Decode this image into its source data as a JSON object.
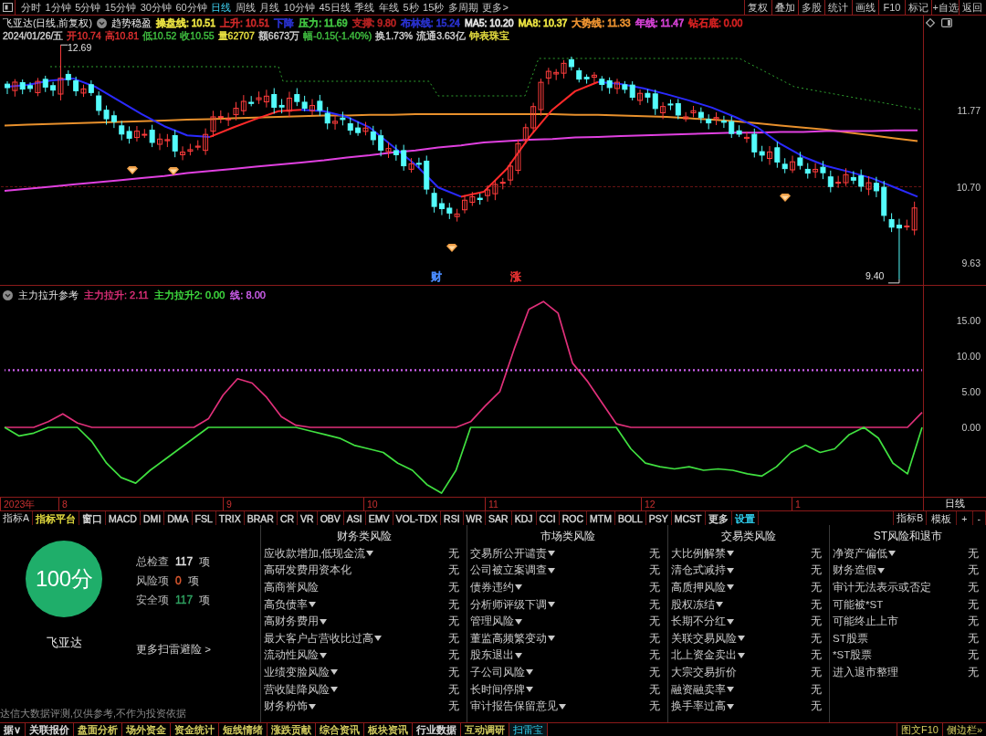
{
  "toolbar": {
    "periods": [
      {
        "label": "分时",
        "selected": false
      },
      {
        "label": "1分钟",
        "selected": false
      },
      {
        "label": "5分钟",
        "selected": false
      },
      {
        "label": "15分钟",
        "selected": false
      },
      {
        "label": "30分钟",
        "selected": false
      },
      {
        "label": "60分钟",
        "selected": false
      },
      {
        "label": "日线",
        "selected": true
      },
      {
        "label": "周线",
        "selected": false
      },
      {
        "label": "月线",
        "selected": false
      },
      {
        "label": "10分钟",
        "selected": false
      },
      {
        "label": "45日线",
        "selected": false
      },
      {
        "label": "季线",
        "selected": false
      },
      {
        "label": "年线",
        "selected": false
      },
      {
        "label": "5秒",
        "selected": false
      },
      {
        "label": "15秒",
        "selected": false
      },
      {
        "label": "多周期",
        "selected": false
      }
    ],
    "more": "更多>",
    "buttons": [
      "复权",
      "叠加",
      "多股",
      "统计",
      "画线",
      "F10",
      "标记",
      "+自选",
      "返回"
    ]
  },
  "price_chart": {
    "title": "飞亚达(日线,前复权)",
    "indicator_name": "趋势稳盈",
    "indicator_values": [
      {
        "text": "操盘线: 10.51",
        "color": "#e8e040"
      },
      {
        "text": "上升: 10.51",
        "color": "#c82828"
      },
      {
        "text": "下降",
        "color": "#2830c8"
      },
      {
        "text": "压力: 11.69",
        "color": "#40c040"
      },
      {
        "text": "支撑: 9.80",
        "color": "#b02020"
      },
      {
        "text": "布林线: 15.24",
        "color": "#2830c8"
      },
      {
        "text": "MA5: 10.20",
        "color": "#e0e0e0"
      },
      {
        "text": "MA8: 10.37",
        "color": "#e8e040"
      },
      {
        "text": "大势线: 11.33",
        "color": "#e89030"
      },
      {
        "text": "年线: 11.47",
        "color": "#d040d0"
      },
      {
        "text": "钻石底: 0.00",
        "color": "#d02020"
      }
    ],
    "bar_info": [
      {
        "text": "2024/01/26/五",
        "color": "#d0d0d0"
      },
      {
        "text": "开10.74",
        "color": "#e03030"
      },
      {
        "text": "高10.81",
        "color": "#e03030"
      },
      {
        "text": "低10.52",
        "color": "#40c040"
      },
      {
        "text": "收10.55",
        "color": "#40c040"
      },
      {
        "text": "量62707",
        "color": "#e8e040"
      },
      {
        "text": "额6673万",
        "color": "#d0d0d0"
      },
      {
        "text": "幅-0.15(-1.40%)",
        "color": "#40c040"
      },
      {
        "text": "换1.73%",
        "color": "#d0d0d0"
      },
      {
        "text": "流通3.63亿",
        "color": "#d0d0d0"
      },
      {
        "text": "钟表珠宝",
        "color": "#e8e040"
      }
    ],
    "price_axis": [
      "11.77",
      "10.70",
      "9.63"
    ],
    "high_label": "12.69",
    "low_label": "9.40",
    "markers": [
      {
        "text": "财",
        "color": "#4a8cff"
      },
      {
        "text": "涨",
        "color": "#e03030"
      }
    ]
  },
  "indicator": {
    "name": "主力拉升参考",
    "chart_data": {
      "type": "line",
      "ylim": [
        -9.7,
        19.8
      ],
      "yticks": [
        {
          "value": 0,
          "label": "0.00"
        },
        {
          "value": 5,
          "label": "5.00"
        },
        {
          "value": 10,
          "label": "10.00"
        },
        {
          "value": 15,
          "label": "15.00"
        }
      ],
      "series": [
        {
          "name": "主力拉升: 2.11",
          "color": "#e0307a",
          "values": [
            0,
            0,
            0,
            0.8,
            1.9,
            0.6,
            0,
            0,
            0,
            0,
            0,
            0,
            0,
            0,
            1.2,
            4.5,
            6.8,
            6.2,
            4.2,
            1.5,
            0.3,
            0,
            0,
            0,
            0,
            0,
            0,
            0,
            0,
            0,
            0,
            0,
            0.8,
            3,
            5,
            11,
            16.5,
            17.6,
            16,
            9,
            6.5,
            3.5,
            0.5,
            0,
            0,
            0,
            0,
            0,
            0,
            0,
            0,
            0,
            0,
            0,
            0,
            0,
            0,
            0,
            0,
            0,
            0,
            0,
            0,
            2.1
          ]
        },
        {
          "name": "主力拉升2: 0.00",
          "color": "#40e040",
          "values": [
            0,
            -1.2,
            -0.8,
            0,
            0,
            0,
            -2,
            -5,
            -7,
            -7.8,
            -6,
            -4.5,
            -3,
            -1.5,
            0,
            0,
            0,
            0,
            0,
            0,
            0,
            -0.5,
            -1,
            -1.5,
            -2.5,
            -3,
            -3.5,
            -5,
            -6,
            -8,
            -9.2,
            -6,
            0,
            0,
            0,
            0,
            0,
            0,
            0,
            0,
            0,
            0,
            0,
            -3,
            -5,
            -5.5,
            -5.8,
            -5.5,
            -6,
            -5.8,
            -6,
            -6.5,
            -6.8,
            -5.5,
            -3.5,
            -2.5,
            -3.5,
            -3,
            -1,
            0,
            -1.5,
            -5,
            -6.5,
            0
          ]
        },
        {
          "name": "线: 8.00",
          "color": "#d060f0",
          "line_style": "dashed",
          "values": [
            8,
            8,
            8,
            8,
            8,
            8,
            8,
            8,
            8,
            8,
            8,
            8,
            8,
            8,
            8,
            8,
            8,
            8,
            8,
            8,
            8,
            8,
            8,
            8,
            8,
            8,
            8,
            8,
            8,
            8,
            8,
            8,
            8,
            8,
            8,
            8,
            8,
            8,
            8,
            8,
            8,
            8,
            8,
            8,
            8,
            8,
            8,
            8,
            8,
            8,
            8,
            8,
            8,
            8,
            8,
            8,
            8,
            8,
            8,
            8,
            8,
            8,
            8,
            8
          ]
        }
      ]
    }
  },
  "date_axis": {
    "labels": [
      "2023年",
      "8",
      "9",
      "10",
      "11",
      "12",
      "1"
    ],
    "period": "日线"
  },
  "indicator_tabs": {
    "left_label": "指标A",
    "tabs": [
      {
        "label": "指标平台",
        "color": "#e8e040"
      },
      {
        "label": "窗口",
        "color": "#d8d8d8"
      },
      {
        "label": "MACD",
        "color": "#d8d8d8"
      },
      {
        "label": "DMI",
        "color": "#d8d8d8"
      },
      {
        "label": "DMA",
        "color": "#d8d8d8"
      },
      {
        "label": "FSL",
        "color": "#d8d8d8"
      },
      {
        "label": "TRIX",
        "color": "#d8d8d8"
      },
      {
        "label": "BRAR",
        "color": "#d8d8d8"
      },
      {
        "label": "CR",
        "color": "#d8d8d8"
      },
      {
        "label": "VR",
        "color": "#d8d8d8"
      },
      {
        "label": "OBV",
        "color": "#d8d8d8"
      },
      {
        "label": "ASI",
        "color": "#d8d8d8"
      },
      {
        "label": "EMV",
        "color": "#d8d8d8"
      },
      {
        "label": "VOL-TDX",
        "color": "#d8d8d8"
      },
      {
        "label": "RSI",
        "color": "#d8d8d8"
      },
      {
        "label": "WR",
        "color": "#d8d8d8"
      },
      {
        "label": "SAR",
        "color": "#d8d8d8"
      },
      {
        "label": "KDJ",
        "color": "#d8d8d8"
      },
      {
        "label": "CCI",
        "color": "#d8d8d8"
      },
      {
        "label": "ROC",
        "color": "#d8d8d8"
      },
      {
        "label": "MTM",
        "color": "#d8d8d8"
      },
      {
        "label": "BOLL",
        "color": "#d8d8d8"
      },
      {
        "label": "PSY",
        "color": "#d8d8d8"
      },
      {
        "label": "MCST",
        "color": "#d8d8d8"
      },
      {
        "label": "更多",
        "color": "#d8d8d8"
      },
      {
        "label": "设置",
        "color": "#30d0f0"
      }
    ],
    "right_label": "指标B",
    "right_buttons": [
      "模板",
      "+",
      "-"
    ]
  },
  "risk_scan": {
    "score": "100分",
    "stock_name": "飞亚达",
    "stats": [
      {
        "label": "总检查",
        "value": "117",
        "unit": "项",
        "color": "#e0e0e0"
      },
      {
        "label": "风险项",
        "value": "0",
        "unit": "项",
        "color": "#e05a30"
      },
      {
        "label": "安全项",
        "value": "117",
        "unit": "项",
        "color": "#2fa060"
      }
    ],
    "more_link": "更多扫雷避险 >",
    "disclaimer": "达信大数据评测,仅供参考,不作为投资依据",
    "columns": [
      {
        "title": "财务类风险",
        "rows": [
          {
            "label": "应收款增加,低现金流",
            "expandable": true,
            "result": "无"
          },
          {
            "label": "高研发费用资本化",
            "expandable": false,
            "result": "无"
          },
          {
            "label": "高商誉风险",
            "expandable": false,
            "result": "无"
          },
          {
            "label": "高负债率",
            "expandable": true,
            "result": "无"
          },
          {
            "label": "高财务费用",
            "expandable": true,
            "result": "无"
          },
          {
            "label": "最大客户占营收比过高",
            "expandable": true,
            "result": "无"
          },
          {
            "label": "流动性风险",
            "expandable": true,
            "result": "无"
          },
          {
            "label": "业绩变脸风险",
            "expandable": true,
            "result": "无"
          },
          {
            "label": "营收陡降风险",
            "expandable": true,
            "result": "无"
          },
          {
            "label": "财务粉饰",
            "expandable": true,
            "result": "无"
          }
        ]
      },
      {
        "title": "市场类风险",
        "rows": [
          {
            "label": "交易所公开谴责",
            "expandable": true,
            "result": "无"
          },
          {
            "label": "公司被立案调查",
            "expandable": true,
            "result": "无"
          },
          {
            "label": "债券违约",
            "expandable": true,
            "result": "无"
          },
          {
            "label": "分析师评级下调",
            "expandable": true,
            "result": "无"
          },
          {
            "label": "管理风险",
            "expandable": true,
            "result": "无"
          },
          {
            "label": "董监高频繁变动",
            "expandable": true,
            "result": "无"
          },
          {
            "label": "股东退出",
            "expandable": true,
            "result": "无"
          },
          {
            "label": "子公司风险",
            "expandable": true,
            "result": "无"
          },
          {
            "label": "长时间停牌",
            "expandable": true,
            "result": "无"
          },
          {
            "label": "审计报告保留意见",
            "expandable": true,
            "result": "无"
          }
        ]
      },
      {
        "title": "交易类风险",
        "rows": [
          {
            "label": "大比例解禁",
            "expandable": true,
            "result": "无"
          },
          {
            "label": "清仓式减持",
            "expandable": true,
            "result": "无"
          },
          {
            "label": "高质押风险",
            "expandable": true,
            "result": "无"
          },
          {
            "label": "股权冻结",
            "expandable": true,
            "result": "无"
          },
          {
            "label": "长期不分红",
            "expandable": true,
            "result": "无"
          },
          {
            "label": "关联交易风险",
            "expandable": true,
            "result": "无"
          },
          {
            "label": "北上资金卖出",
            "expandable": true,
            "result": "无"
          },
          {
            "label": "大宗交易折价",
            "expandable": false,
            "result": "无"
          },
          {
            "label": "融资融卖率",
            "expandable": true,
            "result": "无"
          },
          {
            "label": "换手率过高",
            "expandable": true,
            "result": "无"
          }
        ]
      },
      {
        "title": "ST风险和退市",
        "rows": [
          {
            "label": "净资产偏低",
            "expandable": true,
            "result": "无"
          },
          {
            "label": "财务造假",
            "expandable": true,
            "result": "无"
          },
          {
            "label": "审计无法表示或否定",
            "expandable": false,
            "result": "无"
          },
          {
            "label": "可能被*ST",
            "expandable": false,
            "result": "无"
          },
          {
            "label": "可能终止上市",
            "expandable": false,
            "result": "无"
          },
          {
            "label": "ST股票",
            "expandable": false,
            "result": "无"
          },
          {
            "label": "*ST股票",
            "expandable": false,
            "result": "无"
          },
          {
            "label": "进入退市整理",
            "expandable": false,
            "result": "无"
          }
        ]
      }
    ]
  },
  "status_bar": {
    "tabs": [
      {
        "label": "据∨",
        "selected": false,
        "color": "#e0e0e0"
      },
      {
        "label": "关联报价",
        "selected": false,
        "color": "#e0e0e0"
      },
      {
        "label": "盘面分析",
        "selected": false,
        "color": "#d8d060"
      },
      {
        "label": "场外资金",
        "selected": false,
        "color": "#d8d060"
      },
      {
        "label": "资金统计",
        "selected": false,
        "color": "#d8d060"
      },
      {
        "label": "短线情绪",
        "selected": false,
        "color": "#d8d060"
      },
      {
        "label": "涨跌贡献",
        "selected": false,
        "color": "#d8d060"
      },
      {
        "label": "综合资讯",
        "selected": false,
        "color": "#d8d060"
      },
      {
        "label": "板块资讯",
        "selected": false,
        "color": "#d8d060"
      },
      {
        "label": "行业数据",
        "selected": false,
        "color": "#e0e0e0"
      },
      {
        "label": "互动调研",
        "selected": false,
        "color": "#d8d060"
      },
      {
        "label": "扫雷宝",
        "selected": true
      }
    ],
    "side_links": [
      "图文F10",
      "侧边栏»"
    ]
  }
}
